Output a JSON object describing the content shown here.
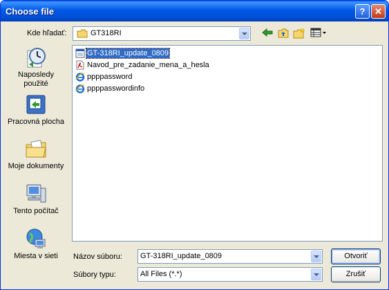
{
  "window": {
    "title": "Choose file",
    "help_button": "?",
    "close_button": "✕"
  },
  "toolbar": {
    "look_in_label": "Kde hľadať:",
    "look_in_value": "GT318RI",
    "icons": [
      "back-icon",
      "up-folder-icon",
      "new-folder-icon",
      "view-menu-icon"
    ]
  },
  "places": [
    {
      "label": "Naposledy použité",
      "icon": "recent-icon"
    },
    {
      "label": "Pracovná plocha",
      "icon": "desktop-icon"
    },
    {
      "label": "Moje dokumenty",
      "icon": "my-documents-icon"
    },
    {
      "label": "Tento počítač",
      "icon": "my-computer-icon"
    },
    {
      "label": "Miesta v sieti",
      "icon": "network-icon"
    }
  ],
  "files": [
    {
      "name": "GT-318RI_update_0809",
      "icon": "binary-file-icon",
      "selected": true
    },
    {
      "name": "Navod_pre_zadanie_mena_a_hesla",
      "icon": "pdf-file-icon",
      "selected": false
    },
    {
      "name": "ppppassword",
      "icon": "ie-file-icon",
      "selected": false
    },
    {
      "name": "ppppasswordinfo",
      "icon": "ie-file-icon",
      "selected": false
    }
  ],
  "footer": {
    "filename_label": "Názov súboru:",
    "filename_value": "GT-318RI_update_0809",
    "filetype_label": "Súbory typu:",
    "filetype_value": "All Files (*.*)",
    "open_button": "Otvoriť",
    "cancel_button": "Zrušiť"
  },
  "colors": {
    "titlebar": "#0058E6",
    "dialog_bg": "#ECE9D8",
    "selection": "#316AC5"
  }
}
